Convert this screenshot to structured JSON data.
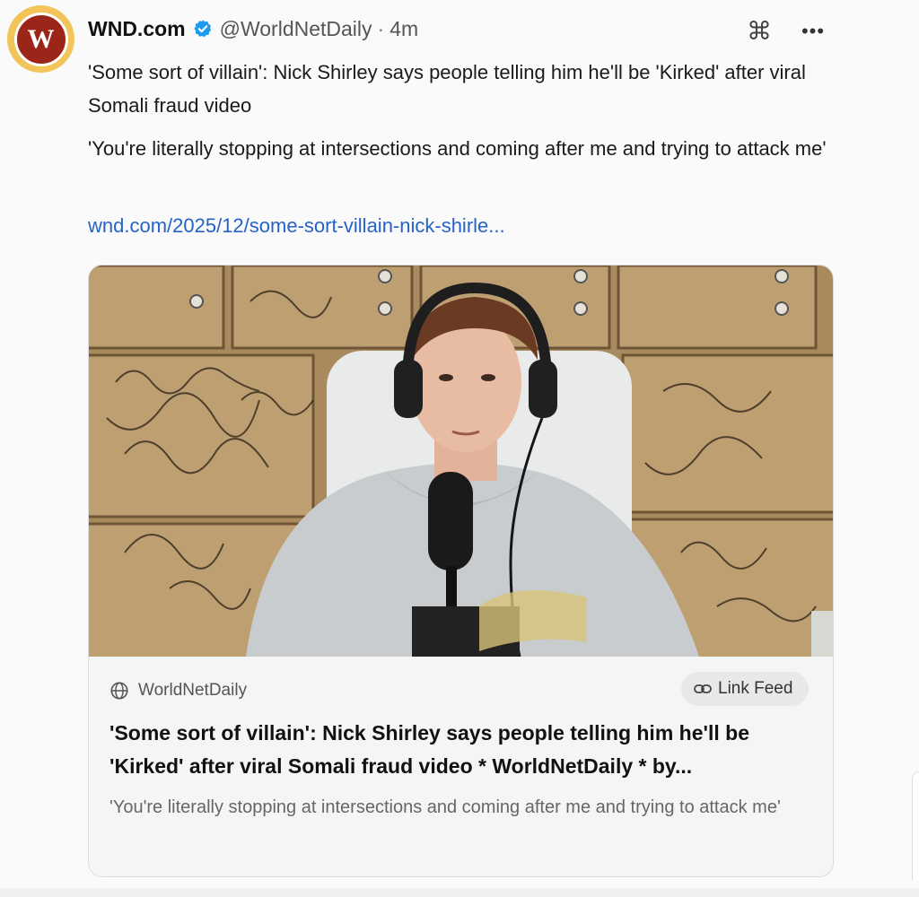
{
  "post": {
    "avatar_letter": "W",
    "display_name": "WND.com",
    "handle": "@WorldNetDaily",
    "separator": "·",
    "time": "4m",
    "text_1": "'Some sort of villain': Nick Shirley says people telling him he'll be 'Kirked' after viral Somali fraud video",
    "text_2": "'You're literally stopping at intersections and coming after me and trying to attack me'",
    "link": "wnd.com/2025/12/some-sort-villain-nick-shirle..."
  },
  "card": {
    "source": "WorldNetDaily",
    "link_feed_label": "Link Feed",
    "title": "'Some sort of villain': Nick Shirley says people telling him he'll be 'Kirked' after viral Somali fraud video * WorldNetDaily * by...",
    "description": "'You're literally stopping at intersections and coming after me and trying to attack me'"
  },
  "icons": {
    "verified": "verified-badge-icon",
    "command": "command-icon",
    "more": "more-icon",
    "globe": "globe-icon",
    "link": "link-icon"
  },
  "colors": {
    "accent_link": "#2563c7",
    "avatar_red": "#9b2518",
    "avatar_gold": "#f2c45a",
    "verified_blue": "#1d9bf0"
  }
}
